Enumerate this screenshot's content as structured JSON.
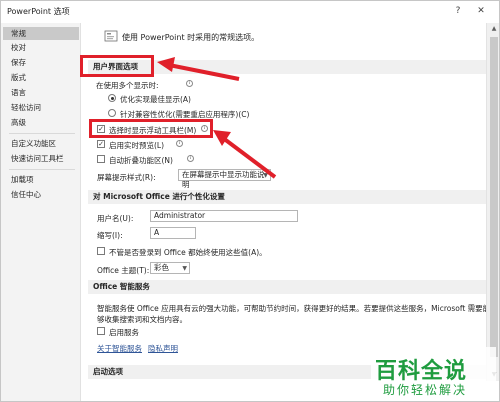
{
  "window": {
    "title": "PowerPoint 选项",
    "help_glyph": "?",
    "close_glyph": "✕"
  },
  "sidebar": {
    "items": [
      {
        "label": "常规",
        "active": true
      },
      {
        "label": "校对"
      },
      {
        "label": "保存"
      },
      {
        "label": "版式"
      },
      {
        "label": "语言"
      },
      {
        "label": "轻松访问"
      },
      {
        "label": "高级"
      },
      {
        "label": "自定义功能区"
      },
      {
        "label": "快速访问工具栏"
      },
      {
        "label": "加载项"
      },
      {
        "label": "信任中心"
      }
    ]
  },
  "intro": {
    "text": "使用 PowerPoint 时采用的常规选项。"
  },
  "ui_options": {
    "header": "用户界面选项",
    "multi_display_label": "在使用多个显示时:",
    "radio_optimize_appearance": "优化实现最佳显示(A)",
    "radio_optimize_compat": "针对兼容性优化(需要重启应用程序)(C)",
    "mini_toolbar": "选择时显示浮动工具栏(M)",
    "live_preview": "启用实时预览(L)",
    "collapse_ribbon": "自动折叠功能区(N)",
    "screentip_label": "屏幕提示样式(R):",
    "screentip_value": "在屏幕提示中显示功能说明"
  },
  "personalize": {
    "header": "对 Microsoft Office 进行个性化设置",
    "username_label": "用户名(U):",
    "username_value": "Administrator",
    "initials_label": "缩写(I):",
    "initials_value": "A",
    "always_use_label": "不管是否登录到 Office 都始终使用这些值(A)。",
    "theme_label": "Office 主题(T):",
    "theme_value": "彩色"
  },
  "intelligent": {
    "header": "Office 智能服务",
    "desc_line1": "智能服务使 Office 应用具有云的强大功能，可帮助节约时间，获得更好的结果。若要提供这些服务，Microsoft 需要能",
    "desc_line2": "够收集搜索词和文档内容。",
    "enable_label": "启用服务",
    "link_about": "关于智能服务",
    "link_privacy": "隐私声明"
  },
  "startup": {
    "header": "启动选项"
  },
  "watermark": {
    "logo": "百科全说",
    "sub": "助你轻松解决"
  },
  "colors": {
    "highlight_red": "#e0202a",
    "watermark_green": "#1f9c3f",
    "nav_active": "#c9c9c9"
  },
  "icons": [
    "question-icon",
    "close-icon",
    "options-icon",
    "info-icon",
    "chevron-down-icon",
    "arrow-up-icon",
    "arrow-down-icon"
  ]
}
